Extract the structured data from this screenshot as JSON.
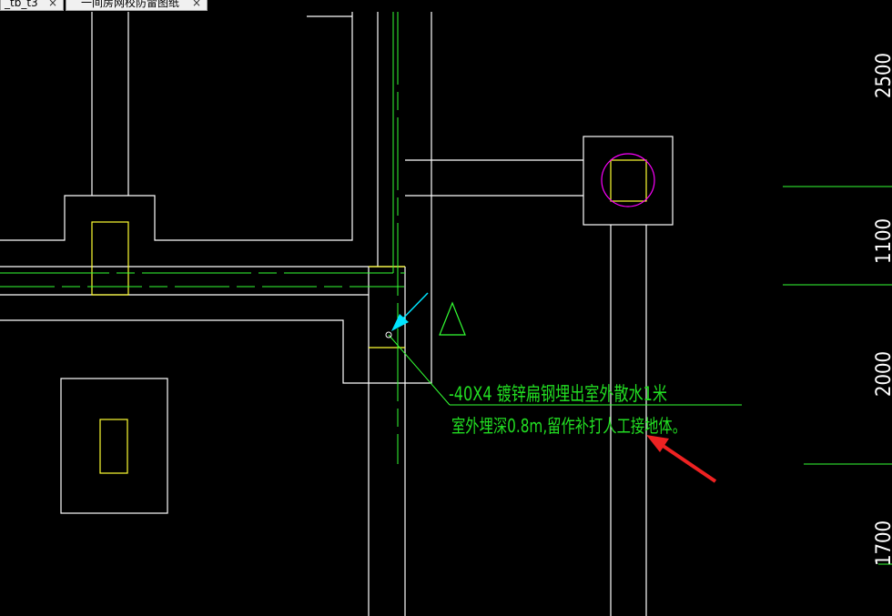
{
  "tabs": [
    {
      "label": "_tb_t3",
      "close": "×"
    },
    {
      "label": "一间房网校防雷图纸",
      "close": "×"
    }
  ],
  "annotation": {
    "line1": "-40X4 镀锌扁钢埋出室外散水1米",
    "line2": "室外埋深0.8m,留作补打人工接地体。"
  },
  "dimensions": [
    "2500",
    "1100",
    "2000",
    "1700"
  ],
  "colors": {
    "background": "#000000",
    "walls": "#ffffff",
    "columns": "#ffff33",
    "grounding_line": "#33ff33",
    "annotation": "#22dd22",
    "circle": "#ff00ff",
    "cursor": "#00e5ff",
    "pointer_arrow": "#ee2222"
  },
  "icons": [
    "triangle-marker-icon",
    "cursor-arrow-icon",
    "red-pointer-arrow-icon"
  ]
}
